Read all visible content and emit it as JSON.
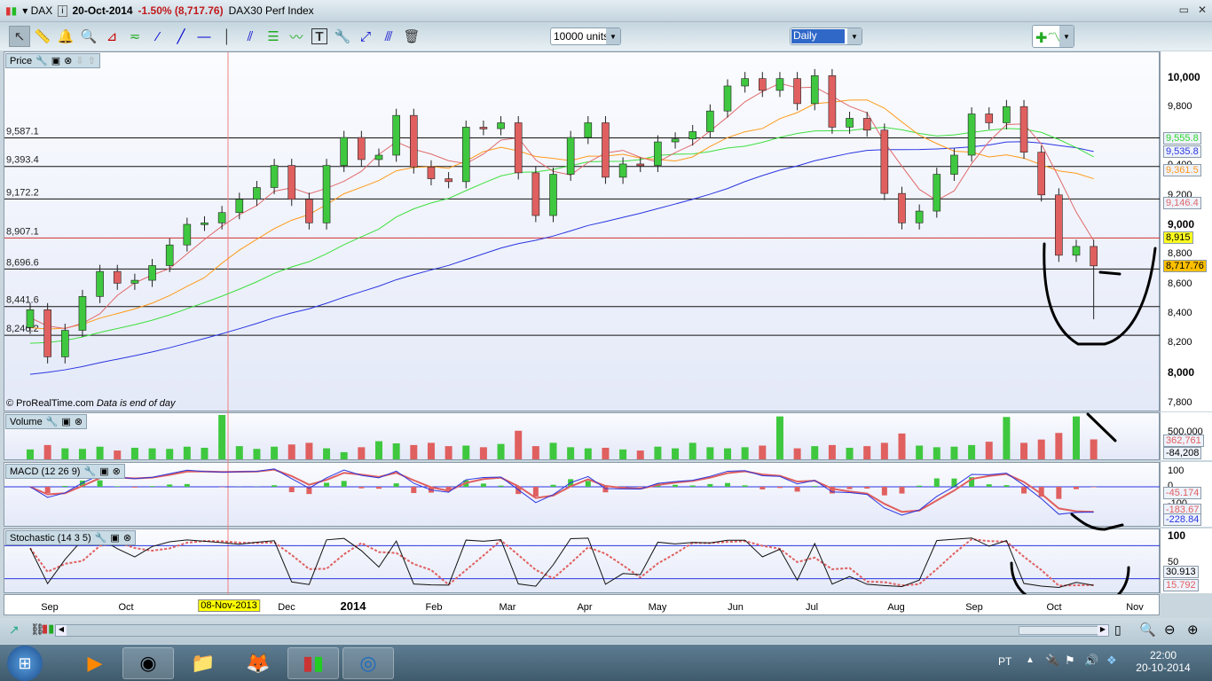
{
  "title": {
    "symbol": "DAX",
    "date": "20-Oct-2014",
    "change": "-1.50% (8,717.76)",
    "name": "DAX30 Perf Index"
  },
  "toolbar": {
    "tools": [
      "pointer",
      "ruler",
      "alert-bell",
      "zoom",
      "triangle",
      "channel",
      "segment",
      "line",
      "horizontal-line",
      "vertical-line",
      "fibonacci",
      "regression",
      "trend-lines",
      "text",
      "properties",
      "arrow",
      "parallel",
      "trash"
    ],
    "units": "10000 units",
    "period": "Daily"
  },
  "panels": {
    "price": {
      "label": "Price",
      "copyright": "© ProRealTime.com",
      "note": "Data is end of day",
      "ticks": [
        "10,000",
        "9,800",
        "9,400",
        "9,200",
        "9,000",
        "8,800",
        "8,600",
        "8,400",
        "8,200",
        "8,000",
        "7,800"
      ],
      "hlines": [
        "9,587.1",
        "9,393.4",
        "9,172.2",
        "8,907.1",
        "8,696.6",
        "8,441.6",
        "8,246.2"
      ],
      "badges": {
        "ma50": "9,555.8",
        "ma200": "9,535.8",
        "ma100": "9,361.5",
        "ma20": "9,146.4",
        "alert": "8,915",
        "last": "8,717.76"
      }
    },
    "volume": {
      "label": "Volume",
      "tick": "500,000",
      "badges": [
        "362,761",
        "-84,208"
      ]
    },
    "macd": {
      "label": "MACD (12 26 9)",
      "ticks": [
        "100",
        "0",
        "-100"
      ],
      "badges": [
        "-45.174",
        "-183.67",
        "-228.84"
      ]
    },
    "stoch": {
      "label": "Stochastic (14 3 5)",
      "ticks": [
        "100",
        "50",
        "0"
      ],
      "badges": [
        "30.913",
        "15.792"
      ]
    }
  },
  "time_axis": {
    "months": [
      "Sep",
      "Oct",
      "Dec",
      "2014",
      "Feb",
      "Mar",
      "Apr",
      "May",
      "Jun",
      "Jul",
      "Aug",
      "Sep",
      "Oct",
      "Nov"
    ],
    "cursor_date": "08-Nov-2013"
  },
  "colors": {
    "up": "#3fc83f",
    "down": "#e06060",
    "ma20": "#e06a6a",
    "ma50": "#ff9a1a",
    "ma100": "#3ee03e",
    "ma200": "#2a36e0",
    "alert_line": "#d03030"
  },
  "chart_data": {
    "type": "candlestick",
    "symbol": "DAX",
    "interval_shown": "weekly approximation of daily chart",
    "ylim": [
      7750,
      10100
    ],
    "dates": [
      "2013-08-23",
      "2013-08-30",
      "2013-09-06",
      "2013-09-13",
      "2013-09-20",
      "2013-09-27",
      "2013-10-04",
      "2013-10-11",
      "2013-10-18",
      "2013-10-25",
      "2013-11-01",
      "2013-11-08",
      "2013-11-15",
      "2013-11-22",
      "2013-11-29",
      "2013-12-06",
      "2013-12-13",
      "2013-12-20",
      "2013-12-27",
      "2014-01-03",
      "2014-01-10",
      "2014-01-17",
      "2014-01-24",
      "2014-01-31",
      "2014-02-07",
      "2014-02-14",
      "2014-02-21",
      "2014-02-28",
      "2014-03-07",
      "2014-03-14",
      "2014-03-21",
      "2014-03-28",
      "2014-04-04",
      "2014-04-11",
      "2014-04-17",
      "2014-04-25",
      "2014-05-02",
      "2014-05-09",
      "2014-05-16",
      "2014-05-23",
      "2014-05-30",
      "2014-06-06",
      "2014-06-13",
      "2014-06-20",
      "2014-06-27",
      "2014-07-04",
      "2014-07-11",
      "2014-07-18",
      "2014-07-25",
      "2014-08-01",
      "2014-08-08",
      "2014-08-15",
      "2014-08-22",
      "2014-08-29",
      "2014-09-05",
      "2014-09-12",
      "2014-09-19",
      "2014-09-26",
      "2014-10-03",
      "2014-10-10",
      "2014-10-17",
      "2014-10-20"
    ],
    "close": [
      8420,
      8100,
      8280,
      8510,
      8680,
      8600,
      8620,
      8720,
      8860,
      9000,
      9010,
      9080,
      9170,
      9250,
      9400,
      9170,
      9010,
      9400,
      9590,
      9440,
      9470,
      9740,
      9390,
      9310,
      9290,
      9660,
      9650,
      9690,
      9350,
      9060,
      9340,
      9590,
      9690,
      9320,
      9410,
      9400,
      9560,
      9580,
      9630,
      9770,
      9940,
      9990,
      9910,
      9990,
      9820,
      10010,
      9660,
      9720,
      9640,
      9210,
      9010,
      9090,
      9340,
      9470,
      9750,
      9690,
      9800,
      9490,
      9200,
      8790,
      8850,
      8717.76
    ],
    "volume": [
      180000,
      260000,
      200000,
      190000,
      230000,
      160000,
      210000,
      200000,
      190000,
      230000,
      210000,
      860000,
      240000,
      190000,
      230000,
      270000,
      300000,
      200000,
      130000,
      220000,
      330000,
      290000,
      260000,
      300000,
      240000,
      250000,
      220000,
      280000,
      520000,
      240000,
      300000,
      220000,
      200000,
      210000,
      180000,
      160000,
      230000,
      200000,
      300000,
      220000,
      200000,
      220000,
      250000,
      780000,
      200000,
      240000,
      260000,
      210000,
      240000,
      300000,
      470000,
      250000,
      220000,
      230000,
      260000,
      320000,
      770000,
      300000,
      360000,
      480000,
      780000,
      362761
    ]
  }
}
